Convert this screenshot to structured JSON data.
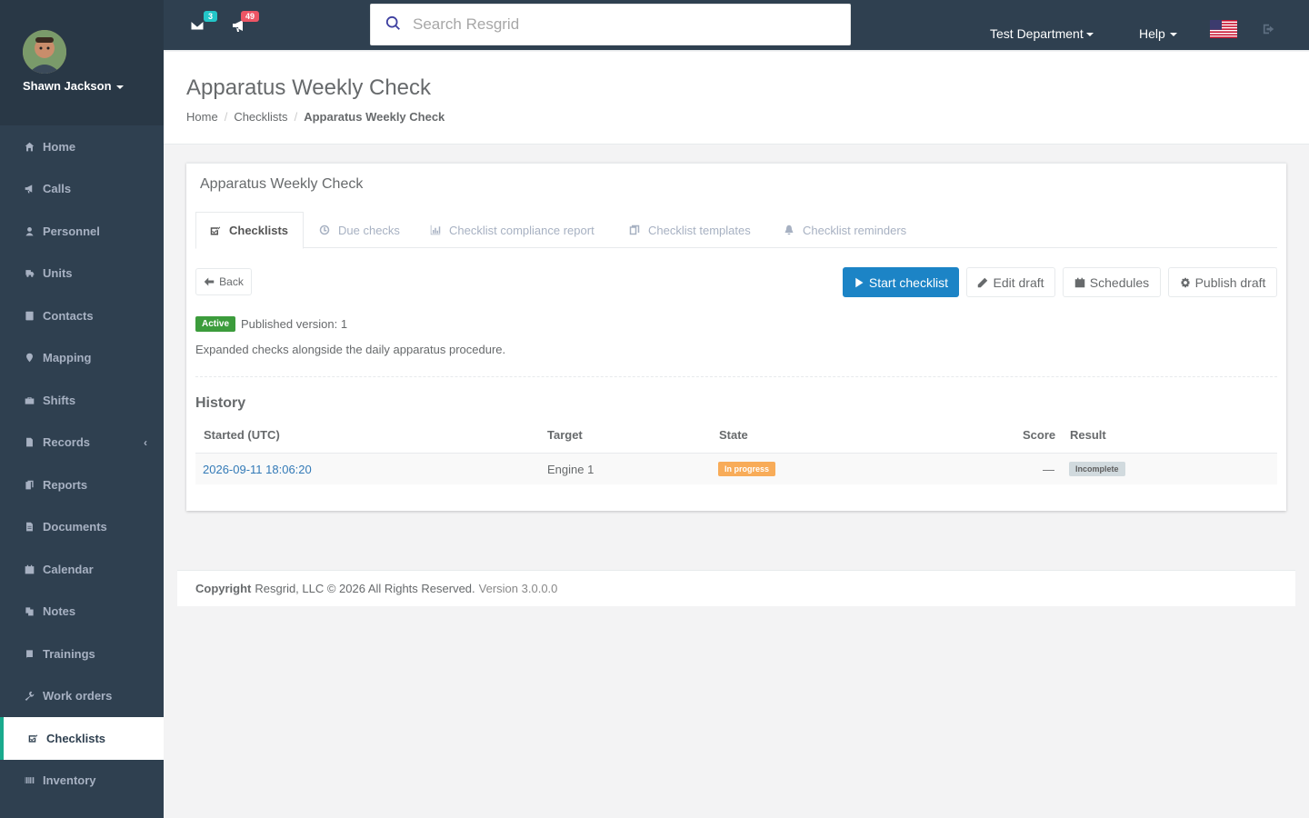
{
  "user": {
    "name": "Shawn Jackson"
  },
  "nav": [
    {
      "label": "Home",
      "icon": "home-icon"
    },
    {
      "label": "Calls",
      "icon": "bullhorn-icon"
    },
    {
      "label": "Personnel",
      "icon": "user-icon"
    },
    {
      "label": "Units",
      "icon": "truck-icon"
    },
    {
      "label": "Contacts",
      "icon": "contact-book-icon"
    },
    {
      "label": "Mapping",
      "icon": "map-marker-icon"
    },
    {
      "label": "Shifts",
      "icon": "briefcase-icon"
    },
    {
      "label": "Records",
      "icon": "file-icon"
    },
    {
      "label": "Reports",
      "icon": "report-icon"
    },
    {
      "label": "Documents",
      "icon": "document-icon"
    },
    {
      "label": "Calendar",
      "icon": "calendar-icon"
    },
    {
      "label": "Notes",
      "icon": "notes-icon"
    },
    {
      "label": "Trainings",
      "icon": "book-icon"
    },
    {
      "label": "Work orders",
      "icon": "wrench-icon"
    },
    {
      "label": "Checklists",
      "icon": "checklist-icon"
    },
    {
      "label": "Inventory",
      "icon": "barcode-icon"
    }
  ],
  "topbar": {
    "messages_count": "3",
    "alerts_count": "49",
    "search_placeholder": "Search Resgrid",
    "department": "Test Department",
    "help": "Help"
  },
  "page": {
    "title": "Apparatus Weekly Check",
    "breadcrumb": [
      "Home",
      "Checklists",
      "Apparatus Weekly Check"
    ]
  },
  "card": {
    "title": "Apparatus Weekly Check",
    "tabs": [
      "Checklists",
      "Due checks",
      "Checklist compliance report",
      "Checklist templates",
      "Checklist reminders"
    ],
    "buttons": {
      "back": "Back",
      "start": "Start checklist",
      "edit": "Edit draft",
      "schedules": "Schedules",
      "publish": "Publish draft"
    },
    "status_label": "Active",
    "published_version": "Published version: 1",
    "description": "Expanded checks alongside the daily apparatus procedure.",
    "history_title": "History",
    "table": {
      "headers": [
        "Started (UTC)",
        "Target",
        "State",
        "Score",
        "Result"
      ],
      "rows": [
        {
          "started": "2026-09-11 18:06:20",
          "target": "Engine 1",
          "state": "In progress",
          "score": "—",
          "result": "Incomplete"
        }
      ]
    }
  },
  "footer": {
    "copyright": "Copyright",
    "text": "Resgrid, LLC © 2026 All Rights Reserved.",
    "version": "Version 3.0.0.0"
  },
  "colors": {
    "sidebar": "#2f4050",
    "primary": "#1c84c6",
    "active_label": "#3c9c3c",
    "warning": "#f8ac59"
  }
}
